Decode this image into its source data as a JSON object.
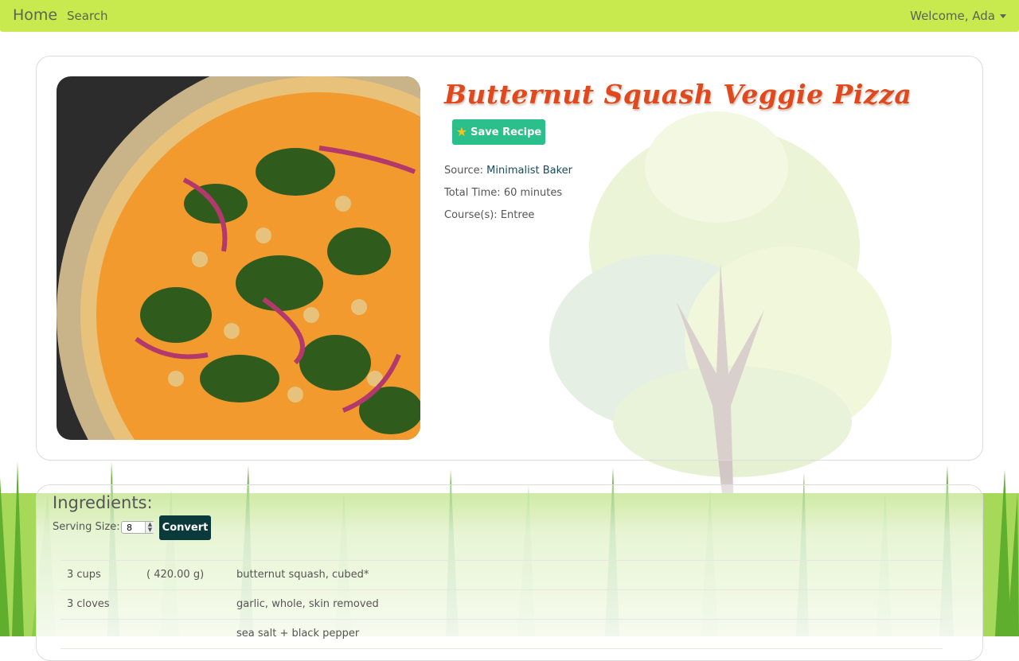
{
  "nav": {
    "home": "Home",
    "search": "Search",
    "welcome": "Welcome, Ada"
  },
  "recipe": {
    "title": "Butternut Squash Veggie Pizza",
    "save_label": "Save Recipe",
    "source_label": "Source:",
    "source_value": "Minimalist Baker",
    "time_label": "Total Time:",
    "time_value": "60 minutes",
    "course_label": "Course(s):",
    "course_value": "Entree"
  },
  "ingredients": {
    "heading": "Ingredients:",
    "serving_label": "Serving Size:",
    "serving_value": "8",
    "convert_label": "Convert",
    "rows": [
      {
        "qty": "3 cups",
        "conv": "( 420.00 g)",
        "name": "butternut squash, cubed*"
      },
      {
        "qty": "3 cloves",
        "conv": "",
        "name": "garlic, whole, skin removed"
      },
      {
        "qty": "",
        "conv": "",
        "name": "sea salt + black pepper"
      }
    ]
  },
  "colors": {
    "nav": "#c8ea4e",
    "title": "#e0491e",
    "save": "#2bbf8c",
    "convert": "#0b3a3a"
  }
}
